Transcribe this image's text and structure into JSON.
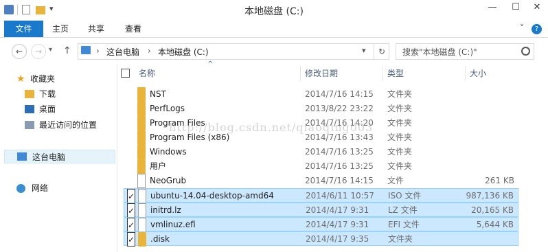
{
  "window": {
    "title": "本地磁盘 (C:)",
    "minimize": "—",
    "maximize": "☐",
    "close": "✕",
    "expand": "˅",
    "help": "?"
  },
  "quick_access": {
    "dropdown": "▾"
  },
  "ribbon": {
    "tabs": [
      "文件",
      "主页",
      "共享",
      "查看"
    ]
  },
  "nav": {
    "back": "←",
    "forward": "→",
    "up": "↑",
    "breadcrumb": [
      "这台电脑",
      "本地磁盘 (C:)"
    ],
    "separator": "›",
    "refresh": "↻",
    "search_placeholder": "搜索\"本地磁盘 (C:)\""
  },
  "sidebar": {
    "favorites_label": "收藏夹",
    "favorites": [
      "下载",
      "桌面",
      "最近访问的位置"
    ],
    "this_pc": "这台电脑",
    "network": "网络"
  },
  "columns": {
    "name": "名称",
    "date": "修改日期",
    "type": "类型",
    "size": "大小",
    "sort_indicator": "^"
  },
  "files": [
    {
      "name": "NST",
      "date": "2014/7/16 14:15",
      "type": "文件夹",
      "size": "",
      "icon": "folder",
      "checked": false
    },
    {
      "name": "PerfLogs",
      "date": "2013/8/22 23:22",
      "type": "文件夹",
      "size": "",
      "icon": "folder",
      "checked": false
    },
    {
      "name": "Program Files",
      "date": "2014/7/16 14:20",
      "type": "文件夹",
      "size": "",
      "icon": "folder",
      "checked": false
    },
    {
      "name": "Program Files (x86)",
      "date": "2014/7/16 13:43",
      "type": "文件夹",
      "size": "",
      "icon": "folder",
      "checked": false
    },
    {
      "name": "Windows",
      "date": "2014/7/16 13:25",
      "type": "文件夹",
      "size": "",
      "icon": "folder",
      "checked": false
    },
    {
      "name": "用户",
      "date": "2014/7/16 13:25",
      "type": "文件夹",
      "size": "",
      "icon": "folder",
      "checked": false
    },
    {
      "name": "NeoGrub",
      "date": "2014/7/16 14:15",
      "type": "文件",
      "size": "261 KB",
      "icon": "doc",
      "checked": false
    },
    {
      "name": "ubuntu-14.04-desktop-amd64",
      "date": "2014/6/11 10:57",
      "type": "ISO 文件",
      "size": "987,136 KB",
      "icon": "disc",
      "checked": true
    },
    {
      "name": "initrd.lz",
      "date": "2014/4/17 9:31",
      "type": "LZ 文件",
      "size": "20,165 KB",
      "icon": "doc",
      "checked": true
    },
    {
      "name": "vmlinuz.efi",
      "date": "2014/4/17 9:31",
      "type": "EFI 文件",
      "size": "5,644 KB",
      "icon": "doc",
      "checked": true
    },
    {
      "name": ".disk",
      "date": "2014/4/17 9:35",
      "type": "文件夹",
      "size": "",
      "icon": "folder",
      "checked": true
    }
  ],
  "watermark": "http://blog.csdn.net/qiaoqing003",
  "colors": {
    "accent": "#1979ca",
    "selection": "#cce8ff",
    "folder": "#e8b43a"
  }
}
